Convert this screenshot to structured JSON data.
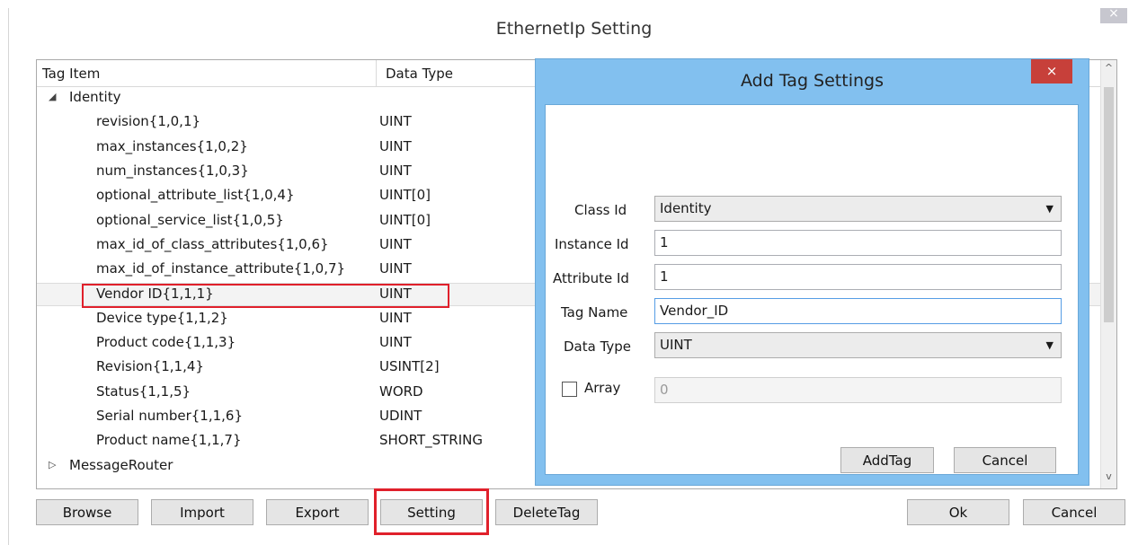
{
  "window": {
    "title": "EthernetIp Setting",
    "close_glyph": "×"
  },
  "grid": {
    "columns": [
      "Tag Item",
      "Data Type"
    ],
    "rows": [
      {
        "name": "Identity",
        "type": "",
        "group": true,
        "expanded": true
      },
      {
        "name": "revision{1,0,1}",
        "type": "UINT"
      },
      {
        "name": "max_instances{1,0,2}",
        "type": "UINT"
      },
      {
        "name": "num_instances{1,0,3}",
        "type": "UINT"
      },
      {
        "name": "optional_attribute_list{1,0,4}",
        "type": "UINT[0]"
      },
      {
        "name": "optional_service_list{1,0,5}",
        "type": "UINT[0]"
      },
      {
        "name": "max_id_of_class_attributes{1,0,6}",
        "type": "UINT"
      },
      {
        "name": "max_id_of_instance_attribute{1,0,7}",
        "type": "UINT"
      },
      {
        "name": "Vendor ID{1,1,1}",
        "type": "UINT",
        "selected": true
      },
      {
        "name": "Device type{1,1,2}",
        "type": "UINT"
      },
      {
        "name": "Product code{1,1,3}",
        "type": "UINT"
      },
      {
        "name": "Revision{1,1,4}",
        "type": "USINT[2]"
      },
      {
        "name": "Status{1,1,5}",
        "type": "WORD"
      },
      {
        "name": "Serial number{1,1,6}",
        "type": "UDINT"
      },
      {
        "name": "Product name{1,1,7}",
        "type": "SHORT_STRING"
      },
      {
        "name": "MessageRouter",
        "type": "",
        "group": true,
        "expanded": false
      }
    ],
    "expanded_glyph": "◢",
    "collapsed_glyph": "▷",
    "scroll_up": "^",
    "scroll_down": "v"
  },
  "buttons": {
    "browse": "Browse",
    "import": "Import",
    "export": "Export",
    "setting": "Setting",
    "delete_tag": "DeleteTag",
    "ok": "Ok",
    "cancel": "Cancel"
  },
  "dialog": {
    "title": "Add Tag Settings",
    "close_glyph": "×",
    "class_id_label": "Class Id",
    "class_id_value": "Identity",
    "instance_id_label": "Instance Id",
    "instance_id_value": "1",
    "attribute_id_label": "Attribute Id",
    "attribute_id_value": "1",
    "tag_name_label": "Tag Name",
    "tag_name_value": "Vendor_ID",
    "data_type_label": "Data Type",
    "data_type_value": "UINT",
    "array_label": "Array",
    "array_value": "0",
    "array_checked": false,
    "add_tag_button": "AddTag",
    "cancel_button": "Cancel",
    "combo_caret": "▼"
  },
  "colors": {
    "highlight_red": "#e0202b",
    "dialog_frame": "#82c0ef",
    "close_red": "#c7403a"
  }
}
